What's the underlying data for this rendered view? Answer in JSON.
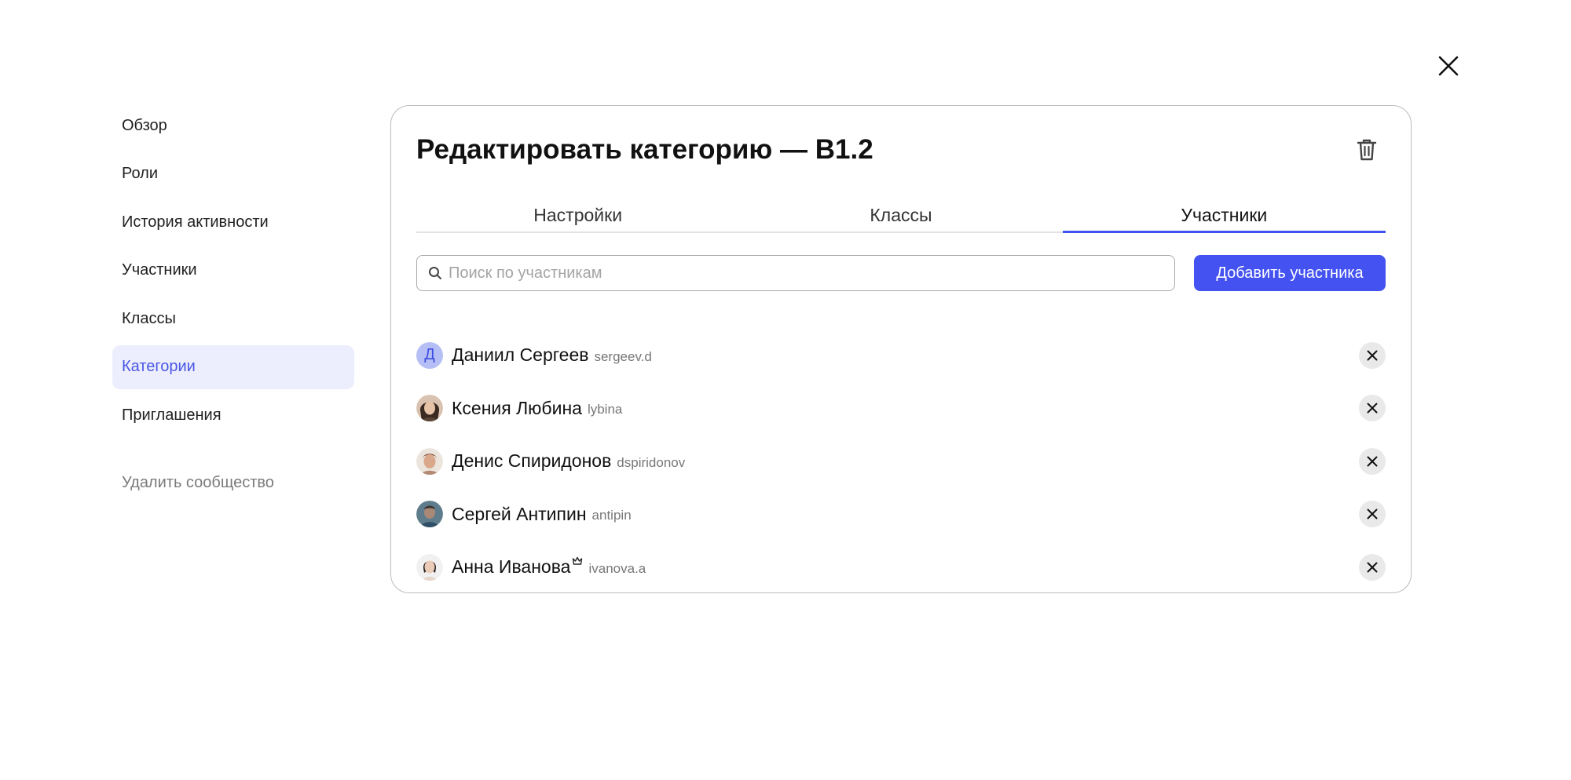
{
  "sidebar": {
    "items": [
      {
        "label": "Обзор"
      },
      {
        "label": "Роли"
      },
      {
        "label": "История активности"
      },
      {
        "label": "Участники"
      },
      {
        "label": "Классы"
      },
      {
        "label": "Категории",
        "active": true
      },
      {
        "label": "Приглашения"
      }
    ],
    "delete_label": "Удалить сообщество"
  },
  "dialog": {
    "title": "Редактировать категорию — B1.2",
    "tabs": [
      {
        "label": "Настройки"
      },
      {
        "label": "Классы"
      },
      {
        "label": "Участники",
        "active": true
      }
    ],
    "search": {
      "placeholder": "Поиск по участникам",
      "value": ""
    },
    "add_button_label": "Добавить участника",
    "members": [
      {
        "name": "Даниил Сергеев",
        "login": "sergeev.d",
        "avatar": "letter",
        "letter": "Д"
      },
      {
        "name": "Ксения Любина",
        "login": "lybina",
        "avatar": "photo"
      },
      {
        "name": "Денис Спиридонов",
        "login": "dspiridonov",
        "avatar": "photo"
      },
      {
        "name": "Сергей Антипин",
        "login": "antipin",
        "avatar": "photo"
      },
      {
        "name": "Анна Иванова",
        "login": "ivanova.a",
        "avatar": "photo",
        "badge": "crown-icon"
      }
    ]
  },
  "colors": {
    "accent": "#4352f0",
    "active_sidebar_bg": "#eceefd",
    "active_sidebar_text": "#4a57e3"
  }
}
